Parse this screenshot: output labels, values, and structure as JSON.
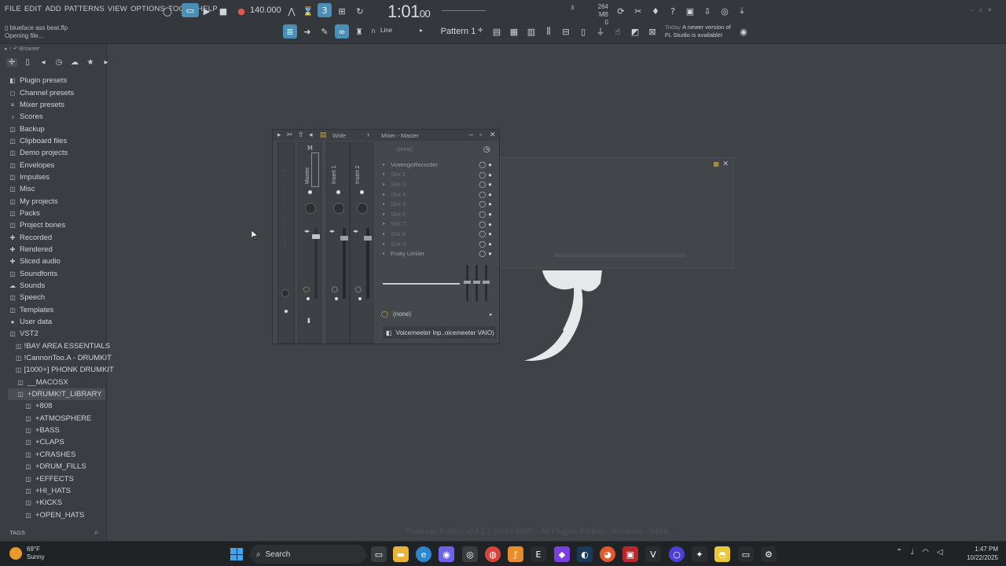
{
  "menu": [
    "FILE",
    "EDIT",
    "ADD",
    "PATTERNS",
    "VIEW",
    "OPTIONS",
    "TOOLS",
    "HELP"
  ],
  "hint": {
    "file": "blueface ass beat.flp",
    "status": "Opening file..."
  },
  "transport": {
    "tempo": "140.000",
    "time_main": "1:01",
    "time_sub": "00",
    "mem": "264 MB",
    "mem2": "0",
    "cpu": "3"
  },
  "toolbar2": {
    "snap": "Line",
    "pattern": "Pattern 1"
  },
  "news": {
    "when": "Today",
    "text1": "A newer version of",
    "text2": "FL Studio is available!"
  },
  "browser": {
    "title": "Browser",
    "items": [
      {
        "icon": "◧",
        "label": "Plugin presets"
      },
      {
        "icon": "◻",
        "label": "Channel presets"
      },
      {
        "icon": "≡",
        "label": "Mixer presets"
      },
      {
        "icon": "♪",
        "label": "Scores"
      },
      {
        "icon": "◫",
        "label": "Backup"
      },
      {
        "icon": "◫",
        "label": "Clipboard files"
      },
      {
        "icon": "◫",
        "label": "Demo projects"
      },
      {
        "icon": "◫",
        "label": "Envelopes"
      },
      {
        "icon": "◫",
        "label": "Impulses"
      },
      {
        "icon": "◫",
        "label": "Misc"
      },
      {
        "icon": "◫",
        "label": "My projects"
      },
      {
        "icon": "◫",
        "label": "Packs"
      },
      {
        "icon": "◫",
        "label": "Project bones"
      },
      {
        "icon": "✚",
        "label": "Recorded"
      },
      {
        "icon": "✚",
        "label": "Rendered"
      },
      {
        "icon": "✚",
        "label": "Sliced audio"
      },
      {
        "icon": "◫",
        "label": "Soundfonts"
      },
      {
        "icon": "☁",
        "label": "Sounds"
      },
      {
        "icon": "◫",
        "label": "Speech"
      },
      {
        "icon": "◫",
        "label": "Templates"
      },
      {
        "icon": "●",
        "label": "User data"
      },
      {
        "icon": "◫",
        "label": "VST2"
      },
      {
        "icon": "◫",
        "label": "!BAY AREA ESSENTIALS",
        "indent": 1
      },
      {
        "icon": "◫",
        "label": "!CannonToo.A - DRUMKIT",
        "indent": 1
      },
      {
        "icon": "◫",
        "label": "[1000+] PHONK DRUMKIT",
        "indent": 1
      },
      {
        "icon": "◫",
        "label": "__MACOSX",
        "indent": 1
      },
      {
        "icon": "◫",
        "label": "+DRUMK!T_LIBRARY",
        "indent": 1,
        "selected": true
      },
      {
        "icon": "◫",
        "label": "+808",
        "indent": 2
      },
      {
        "icon": "◫",
        "label": "+ATMOSPHERE",
        "indent": 2
      },
      {
        "icon": "◫",
        "label": "+BASS",
        "indent": 2
      },
      {
        "icon": "◫",
        "label": "+CLAPS",
        "indent": 2
      },
      {
        "icon": "◫",
        "label": "+CRASHES",
        "indent": 2
      },
      {
        "icon": "◫",
        "label": "+DRUM_FILLS",
        "indent": 2
      },
      {
        "icon": "◫",
        "label": "+EFFECTS",
        "indent": 2
      },
      {
        "icon": "◫",
        "label": "+HI_HATS",
        "indent": 2
      },
      {
        "icon": "◫",
        "label": "+KICKS",
        "indent": 2
      },
      {
        "icon": "◫",
        "label": "+OPEN_HATS",
        "indent": 2
      }
    ],
    "tags": "TAGS"
  },
  "mixer": {
    "title": "Mixer - Master",
    "view": "Wide",
    "strip_m": "M",
    "strips": [
      "Master",
      "Insert 1",
      "Insert 2"
    ],
    "preset": "(none)",
    "slots": [
      "VoxengoRecorder",
      "Slot 2",
      "Slot 3",
      "Slot 4",
      "Slot 5",
      "Slot 6",
      "Slot 7",
      "Slot 8",
      "Slot 9",
      "Fruity Limiter"
    ],
    "route": "(none)",
    "device": "Voicemeeter Inp..oicemeeter VAIO)"
  },
  "watermark": "Producer Edition v24.1.1 [build 4285] - All Plugins Edition - Windows - 64Bit",
  "taskbar": {
    "weather_temp": "69°F",
    "weather_desc": "Sunny",
    "search": "Search",
    "time": "1:47 PM",
    "date": "10/22/2025"
  }
}
